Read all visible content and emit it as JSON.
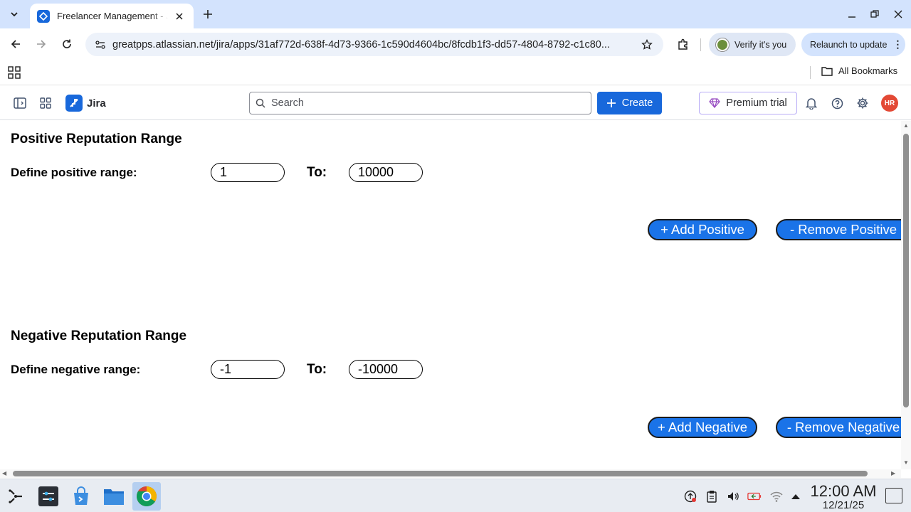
{
  "browser": {
    "tab_title": "Freelancer Management - Jira",
    "url": "greatpps.atlassian.net/jira/apps/31af772d-638f-4d73-9366-1c590d4604bc/8fcdb1f3-dd57-4804-8792-c1c80...",
    "verify_label": "Verify it's you",
    "relaunch_label": "Relaunch to update",
    "all_bookmarks_label": "All Bookmarks"
  },
  "jira": {
    "app_name": "Jira",
    "search_placeholder": "Search",
    "create_label": "Create",
    "premium_label": "Premium trial",
    "avatar_initials": "HR",
    "brand_color": "#1868db"
  },
  "positive": {
    "title": "Positive Reputation Range",
    "label": "Define positive range:",
    "from": "1",
    "to_label": "To:",
    "to": "10000",
    "add_label": "+ Add Positive",
    "remove_label": "- Remove Positive"
  },
  "negative": {
    "title": "Negative Reputation Range",
    "label": "Define negative range:",
    "from": "-1",
    "to_label": "To:",
    "to": "-10000",
    "add_label": "+ Add Negative",
    "remove_label": "- Remove Negative"
  },
  "taskbar": {
    "time": "12:00 AM",
    "date": "12/21/25"
  },
  "icons": [
    "chevron-down-icon",
    "jira-favicon-icon",
    "close-icon",
    "plus-icon",
    "minimize-icon",
    "restore-icon",
    "back-icon",
    "forward-icon",
    "reload-icon",
    "site-info-icon",
    "star-icon",
    "extensions-icon",
    "apps-grid-icon",
    "folder-icon",
    "sidebar-toggle-icon",
    "app-switcher-icon",
    "search-icon",
    "diamond-icon",
    "bell-icon",
    "help-icon",
    "gear-icon"
  ]
}
